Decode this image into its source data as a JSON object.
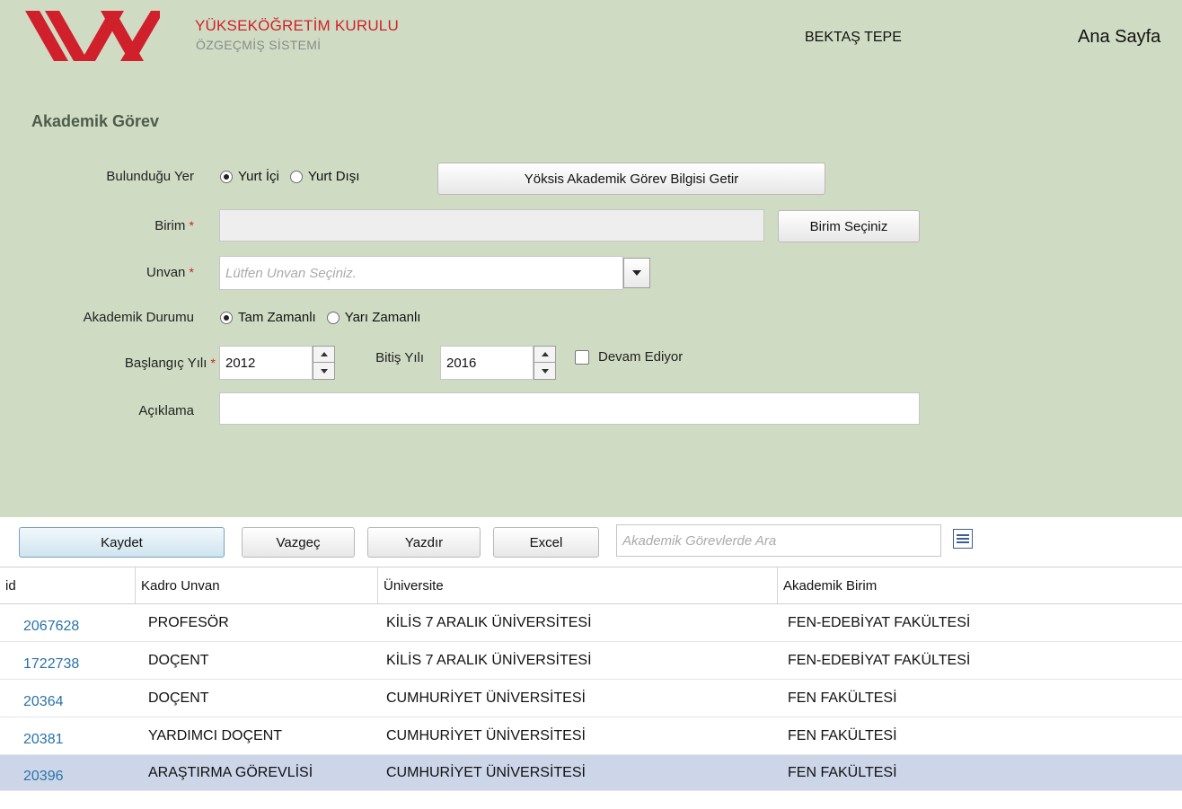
{
  "header": {
    "brand_line1": "YÜKSEKÖĞRETİM KURULU",
    "brand_line2": "ÖZGEÇMİŞ SİSTEMİ",
    "user_name": "BEKTAŞ TEPE",
    "home_link": "Ana Sayfa"
  },
  "form": {
    "title": "Akademik Görev",
    "location_label": "Bulunduğu Yer",
    "location_options": [
      "Yurt İçi",
      "Yurt Dışı"
    ],
    "location_selected": "Yurt İçi",
    "fetch_button": "Yöksis Akademik Görev Bilgisi Getir",
    "unit_label": "Birim",
    "unit_value": "",
    "unit_button": "Birim Seçiniz",
    "title_label": "Unvan",
    "title_placeholder": "Lütfen Unvan Seçiniz.",
    "status_label": "Akademik Durumu",
    "status_options": [
      "Tam Zamanlı",
      "Yarı Zamanlı"
    ],
    "status_selected": "Tam Zamanlı",
    "start_label": "Başlangıç Yılı",
    "start_value": "2012",
    "end_label": "Bitiş Yılı",
    "end_value": "2016",
    "ongoing_label": "Devam Ediyor",
    "ongoing_checked": false,
    "desc_label": "Açıklama",
    "desc_value": "",
    "required_mark": "*"
  },
  "toolbar": {
    "save": "Kaydet",
    "cancel": "Vazgeç",
    "print": "Yazdır",
    "excel": "Excel",
    "search_placeholder": "Akademik Görevlerde Ara"
  },
  "table": {
    "columns": [
      "id",
      "Kadro Unvan",
      "Üniversite",
      "Akademik Birim"
    ],
    "rows": [
      {
        "id": "2067628",
        "unvan": "PROFESÖR",
        "universite": "KİLİS 7 ARALIK ÜNİVERSİTESİ",
        "birim": "FEN-EDEBİYAT FAKÜLTESİ"
      },
      {
        "id": "1722738",
        "unvan": "DOÇENT",
        "universite": "KİLİS 7 ARALIK ÜNİVERSİTESİ",
        "birim": "FEN-EDEBİYAT FAKÜLTESİ"
      },
      {
        "id": "20364",
        "unvan": "DOÇENT",
        "universite": "CUMHURİYET ÜNİVERSİTESİ",
        "birim": "FEN FAKÜLTESİ"
      },
      {
        "id": "20381",
        "unvan": "YARDIMCI DOÇENT",
        "universite": "CUMHURİYET ÜNİVERSİTESİ",
        "birim": "FEN FAKÜLTESİ"
      },
      {
        "id": "20396",
        "unvan": "ARAŞTIRMA GÖREVLİSİ",
        "universite": "CUMHURİYET ÜNİVERSİTESİ",
        "birim": "FEN FAKÜLTESİ"
      }
    ],
    "selected_row": 4
  },
  "colors": {
    "panel_bg": "#cfdcc3",
    "brand_red": "#d0202b",
    "link_blue": "#2a73a8",
    "selected_row": "#ccd6e8"
  }
}
